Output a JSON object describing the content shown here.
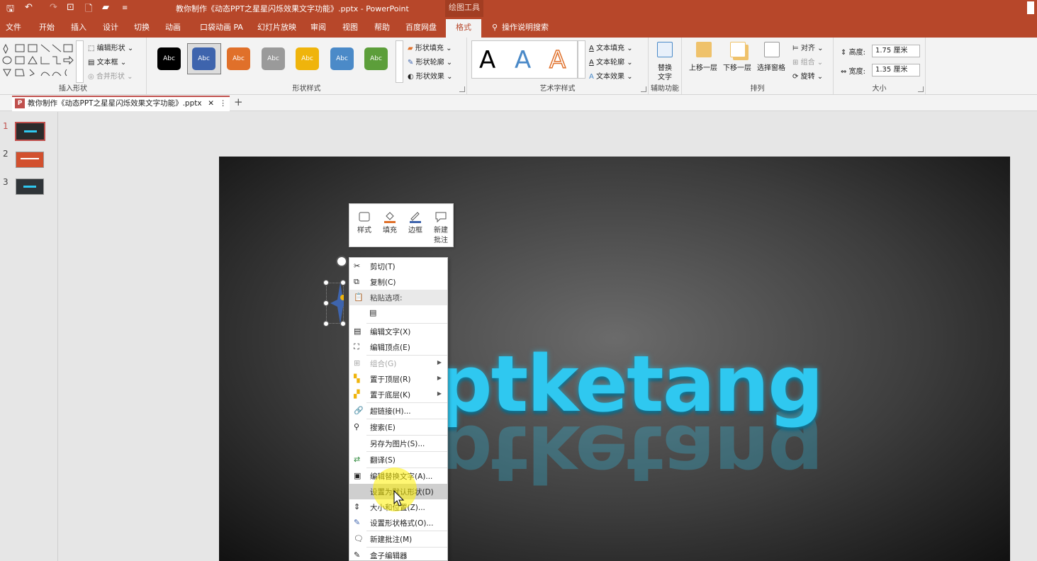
{
  "window": {
    "title": "教你制作《动态PPT之星星闪烁效果文字功能》.pptx  -  PowerPoint",
    "contextual_tab_group": "绘图工具"
  },
  "tabs": [
    {
      "label": "文件"
    },
    {
      "label": "开始"
    },
    {
      "label": "插入"
    },
    {
      "label": "设计"
    },
    {
      "label": "切换"
    },
    {
      "label": "动画"
    },
    {
      "label": "口袋动画 PA"
    },
    {
      "label": "幻灯片放映"
    },
    {
      "label": "审阅"
    },
    {
      "label": "视图"
    },
    {
      "label": "帮助"
    },
    {
      "label": "百度网盘"
    },
    {
      "label": "格式"
    }
  ],
  "tell_me": "操作说明搜索",
  "ribbon": {
    "insert_shapes": {
      "label": "插入形状",
      "edit_shape": "编辑形状",
      "text_box": "文本框",
      "merge_shapes": "合并形状"
    },
    "shape_styles": {
      "label": "形状样式",
      "swatch_text": "Abc",
      "swatches": [
        "#000000",
        "#3e64ad",
        "#e0702a",
        "#9a9a9a",
        "#efb40c",
        "#4b8ac8",
        "#5c9e3a"
      ],
      "shape_fill": "形状填充",
      "shape_outline": "形状轮廓",
      "shape_effects": "形状效果"
    },
    "wordart_styles": {
      "label": "艺术字样式",
      "letter": "A",
      "text_fill": "文本填充",
      "text_outline": "文本轮廓",
      "text_effects": "文本效果"
    },
    "accessibility": {
      "label": "辅助功能",
      "alt_text_line1": "替换",
      "alt_text_line2": "文字"
    },
    "arrange": {
      "label": "排列",
      "bring_forward": "上移一层",
      "send_backward": "下移一层",
      "selection_pane": "选择窗格",
      "align": "对齐",
      "group": "组合",
      "rotate": "旋转"
    },
    "size": {
      "label": "大小",
      "height_label": "高度:",
      "height_value": "1.75 厘米",
      "width_label": "宽度:",
      "width_value": "1.35 厘米"
    }
  },
  "document_tab": {
    "name": "教你制作《动态PPT之星星闪烁效果文字功能》.pptx",
    "close": "✕"
  },
  "thumbnails": [
    {
      "num": "1"
    },
    {
      "num": "2"
    },
    {
      "num": "3"
    }
  ],
  "slide": {
    "text": "ptketang"
  },
  "mini_toolbar": {
    "style": "样式",
    "fill": "填充",
    "border": "边框",
    "new_comment_line1": "新建",
    "new_comment_line2": "批注"
  },
  "context_menu": {
    "cut": "剪切(T)",
    "copy": "复制(C)",
    "paste_options": "粘贴选项:",
    "edit_text": "编辑文字(X)",
    "edit_points": "编辑顶点(E)",
    "group": "组合(G)",
    "bring_to_front": "置于顶层(R)",
    "send_to_back": "置于底层(K)",
    "hyperlink": "超链接(H)...",
    "search": "搜索(E)",
    "save_as_picture": "另存为图片(S)...",
    "translate": "翻译(S)",
    "edit_alt_text": "编辑替换文字(A)...",
    "set_default_shape": "设置为默认形状(D)",
    "size_position": "大小和位置(Z)...",
    "format_shape": "设置形状格式(O)...",
    "new_comment": "新建批注(M)",
    "box_editor": "盒子编辑器"
  }
}
